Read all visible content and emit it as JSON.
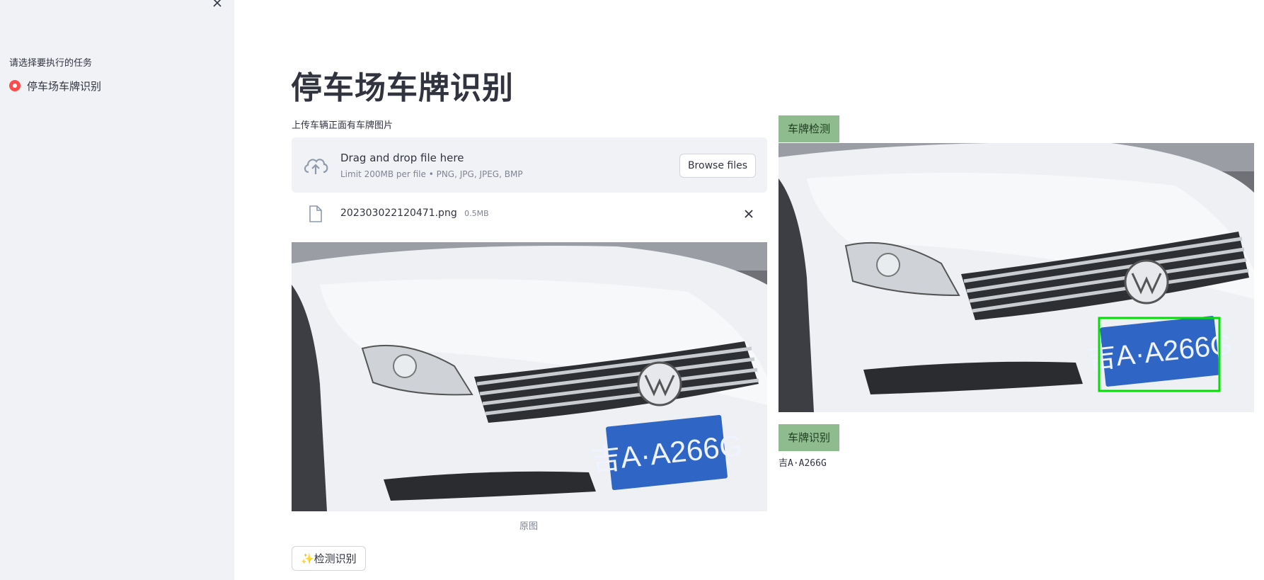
{
  "sidebar": {
    "radio_label": "请选择要执行的任务",
    "options": [
      {
        "label": "停车场车牌识别",
        "selected": true
      }
    ]
  },
  "main": {
    "title": "停车场车牌识别",
    "upload": {
      "label": "上传车辆正面有车牌图片",
      "drop_title": "Drag and drop file here",
      "drop_hint": "Limit 200MB per file • PNG, JPG, JPEG, BMP",
      "browse_label": "Browse files"
    },
    "file": {
      "name": "202303022120471.png",
      "size": "0.5MB"
    },
    "original_caption": "原图",
    "run_button": "✨检测识别",
    "detect_tag": "车牌检测",
    "recog_tag": "车牌识别",
    "plate_result": "吉A·A266G"
  },
  "colors": {
    "accent": "#ff4b4b",
    "tag_bg": "#8fbc8f",
    "detect_box": "#00e000"
  },
  "icons": [
    "close-icon",
    "upload-cloud-icon",
    "file-icon",
    "remove-file-icon"
  ]
}
